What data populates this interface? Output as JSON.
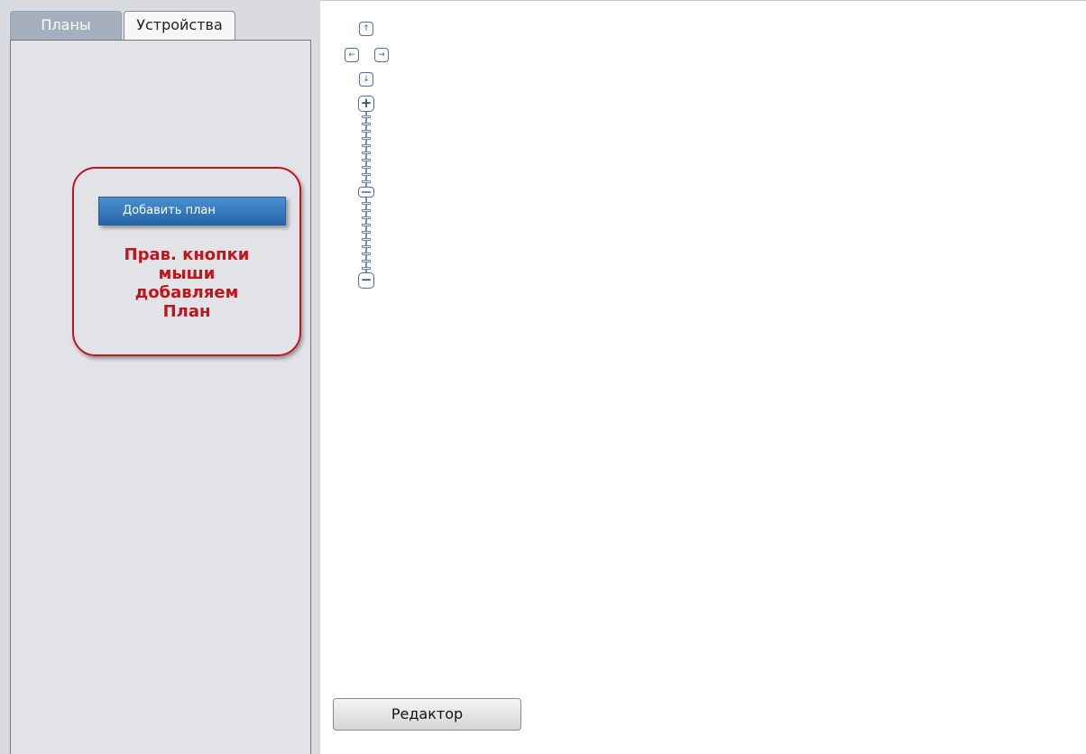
{
  "tabs": [
    {
      "label": "Планы",
      "active": true
    },
    {
      "label": "Устройства",
      "active": false
    }
  ],
  "context_menu": {
    "item_label": "Добавить план"
  },
  "annotation": {
    "text": "Прав. кнопки\nмыши\nдобавляем\nПлан"
  },
  "map_controls": {
    "pan_up_icon": "arrow-up-icon",
    "pan_left_icon": "arrow-left-icon",
    "pan_right_icon": "arrow-right-icon",
    "pan_down_icon": "arrow-down-icon",
    "zoom_in_symbol": "+",
    "zoom_out_symbol": "−",
    "up_symbol": "↑",
    "left_symbol": "←",
    "right_symbol": "→",
    "down_symbol": "↓"
  },
  "editor_button": {
    "label": "Редактор"
  },
  "colors": {
    "accent_blue": "#2d73b8",
    "annotation_red": "#c0151c",
    "panel_bg": "#e2e3e7"
  }
}
